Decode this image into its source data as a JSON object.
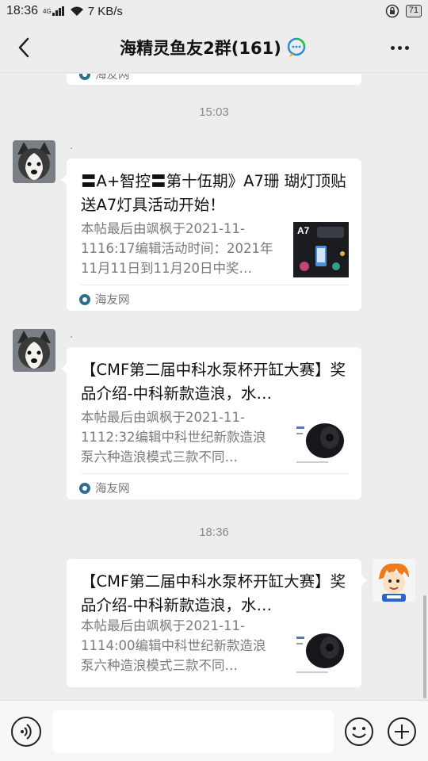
{
  "status_bar": {
    "time": "18:36",
    "network_type": "4G",
    "speed": "7 KB/s",
    "battery": "71"
  },
  "header": {
    "title": "海精灵鱼友2群(161)"
  },
  "messages": {
    "top_partial_source": "海友网",
    "timestamp_1": "15:03",
    "timestamp_2": "18:36",
    "msg1": {
      "sender_name": ".",
      "title": "〓A+智控〓第十伍期》A7珊 瑚灯顶贴送A7灯具活动开始！",
      "desc": "本帖最后由飒枫于2021-11-1116:17编辑活动时间：2021年11月11日到11月20日中奖…",
      "thumb_label": "A7",
      "source": "海友网"
    },
    "msg2": {
      "sender_name": ".",
      "title": "【CMF第二届中科水泵杯开缸大赛】奖品介绍-中科新款造浪，水…",
      "desc": "本帖最后由飒枫于2021-11-1112:32编辑中科世纪新款造浪泵六种造浪模式三款不同…",
      "source": "海友网"
    },
    "msg3": {
      "title": "【CMF第二届中科水泵杯开缸大赛】奖品介绍-中科新款造浪，水…",
      "desc": "本帖最后由飒枫于2021-11-1114:00编辑中科世纪新款造浪泵六种造浪模式三款不同…"
    }
  },
  "input": {
    "placeholder": ""
  },
  "colors": {
    "background": "#ededed",
    "bubble": "#ffffff",
    "secondary_text": "#7a7a7a"
  }
}
